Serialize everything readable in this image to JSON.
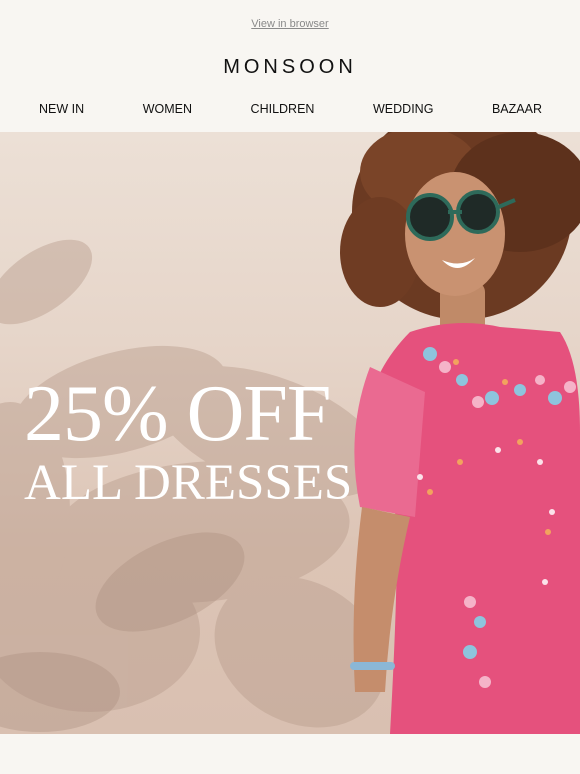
{
  "header": {
    "view_in_browser": "View in browser",
    "brand": "MONSOON"
  },
  "nav": {
    "items": [
      "NEW IN",
      "WOMEN",
      "CHILDREN",
      "WEDDING",
      "BAZAAR"
    ]
  },
  "hero": {
    "headline": "25% OFF",
    "subheadline": "ALL DRESSES"
  },
  "colors": {
    "background": "#f8f6f2",
    "dress_pink": "#e5517d",
    "headline_text": "#ffffff"
  }
}
